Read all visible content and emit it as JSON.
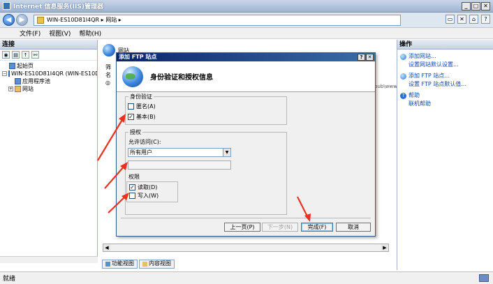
{
  "window": {
    "title": "Internet 信息服务(IIS)管理器"
  },
  "address": {
    "path": "WIN-ES10D81I4QR ▸ 网站 ▸"
  },
  "menu": {
    "items": [
      "文件(F)",
      "视图(V)",
      "帮助(H)"
    ]
  },
  "left_pane": {
    "header": "连接",
    "tree": [
      {
        "label": "起始页",
        "level": 0
      },
      {
        "label": "WIN-ES10D81I4QR (WIN-ES10D",
        "level": 0
      },
      {
        "label": "应用程序池",
        "level": 1
      },
      {
        "label": "网站",
        "level": 1
      }
    ]
  },
  "center": {
    "banner": "网站",
    "bg_tabs": [
      "筛",
      "名",
      "◎"
    ],
    "bg_path": "pub\\www"
  },
  "view_tabs": {
    "features": "功能视图",
    "content": "内容视图"
  },
  "right_pane": {
    "header": "操作",
    "actions": [
      {
        "label": "添加网站...",
        "icon": "globe"
      },
      {
        "label": "设置网站默认设置...",
        "icon": ""
      },
      {
        "label": "添加 FTP 站点...",
        "icon": "globe"
      },
      {
        "label": "设置 FTP 站点默认值...",
        "icon": ""
      },
      {
        "label": "帮助",
        "icon": "help"
      },
      {
        "label": "联机帮助",
        "icon": ""
      }
    ]
  },
  "status": {
    "text": "就绪"
  },
  "dialog": {
    "title": "添加 FTP 站点",
    "heading": "身份验证和授权信息",
    "auth_group": "身份验证",
    "anonymous_label": "匿名(A)",
    "anonymous_checked": false,
    "basic_label": "基本(B)",
    "basic_checked": true,
    "authz_group": "授权",
    "allow_access_label": "允许访问(C):",
    "allow_access_value": "所有用户",
    "perm_group": "权限",
    "read_label": "读取(D)",
    "read_checked": true,
    "write_label": "写入(W)",
    "write_checked": false,
    "buttons": {
      "prev": "上一页(P)",
      "next": "下一步(N)",
      "finish": "完成(F)",
      "cancel": "取消"
    }
  },
  "colors": {
    "accent": "#0a246a",
    "arrow": "#e8321e",
    "link": "#10479c"
  }
}
